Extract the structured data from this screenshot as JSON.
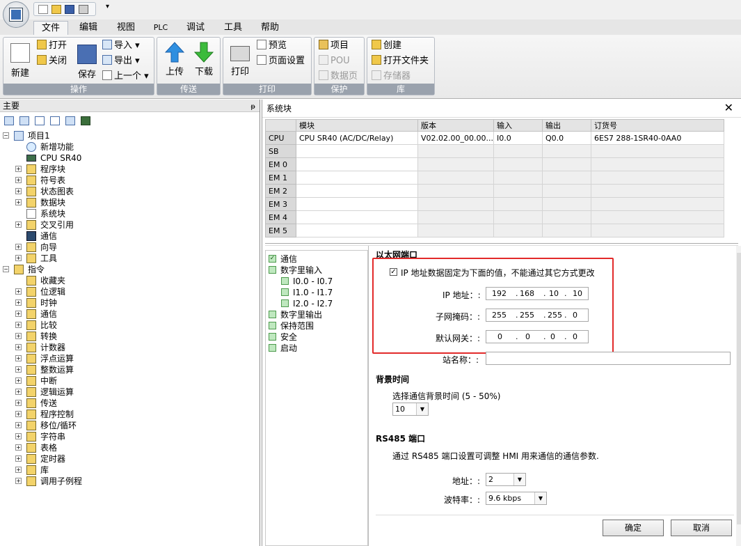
{
  "ribbon_tabs": [
    "文件",
    "编辑",
    "视图",
    "PLC",
    "调试",
    "工具",
    "帮助"
  ],
  "active_tab": "文件",
  "ribbon": {
    "new": "新建",
    "open": "打开",
    "close": "关闭",
    "save": "保存",
    "import": "导入",
    "export": "导出",
    "previous": "上一个",
    "group_ops": "操作",
    "upload": "上传",
    "download": "下载",
    "group_transfer": "传送",
    "print": "打印",
    "preview": "预览",
    "page_setup": "页面设置",
    "group_print": "打印",
    "project": "项目",
    "pou": "POU",
    "data_page": "数据页",
    "group_protect": "保护",
    "create": "创建",
    "open_folder": "打开文件夹",
    "memory": "存储器",
    "group_library": "库"
  },
  "left_panel": {
    "title": "主要",
    "tree": [
      {
        "label": "项目1",
        "indent": 0,
        "expander": "-",
        "icon": "project-icon"
      },
      {
        "label": "新增功能",
        "indent": 1,
        "expander": "",
        "icon": "help-icon"
      },
      {
        "label": "CPU SR40",
        "indent": 1,
        "expander": "",
        "icon": "cpu-icon"
      },
      {
        "label": "程序块",
        "indent": 1,
        "expander": "+",
        "icon": "folder-icon"
      },
      {
        "label": "符号表",
        "indent": 1,
        "expander": "+",
        "icon": "folder-icon"
      },
      {
        "label": "状态图表",
        "indent": 1,
        "expander": "+",
        "icon": "folder-icon"
      },
      {
        "label": "数据块",
        "indent": 1,
        "expander": "+",
        "icon": "folder-icon"
      },
      {
        "label": "系统块",
        "indent": 1,
        "expander": "",
        "icon": "document-icon"
      },
      {
        "label": "交叉引用",
        "indent": 1,
        "expander": "+",
        "icon": "folder-icon"
      },
      {
        "label": "通信",
        "indent": 1,
        "expander": "",
        "icon": "network-icon"
      },
      {
        "label": "向导",
        "indent": 1,
        "expander": "+",
        "icon": "wizard-icon"
      },
      {
        "label": "工具",
        "indent": 1,
        "expander": "+",
        "icon": "folder-icon"
      },
      {
        "label": "指令",
        "indent": 0,
        "expander": "-",
        "icon": "folder-icon"
      },
      {
        "label": "收藏夹",
        "indent": 1,
        "expander": "",
        "icon": "folder-icon"
      },
      {
        "label": "位逻辑",
        "indent": 1,
        "expander": "+",
        "icon": "folder-icon"
      },
      {
        "label": "时钟",
        "indent": 1,
        "expander": "+",
        "icon": "folder-icon"
      },
      {
        "label": "通信",
        "indent": 1,
        "expander": "+",
        "icon": "folder-icon"
      },
      {
        "label": "比较",
        "indent": 1,
        "expander": "+",
        "icon": "folder-icon"
      },
      {
        "label": "转换",
        "indent": 1,
        "expander": "+",
        "icon": "folder-icon"
      },
      {
        "label": "计数器",
        "indent": 1,
        "expander": "+",
        "icon": "folder-icon"
      },
      {
        "label": "浮点运算",
        "indent": 1,
        "expander": "+",
        "icon": "folder-icon"
      },
      {
        "label": "整数运算",
        "indent": 1,
        "expander": "+",
        "icon": "folder-icon"
      },
      {
        "label": "中断",
        "indent": 1,
        "expander": "+",
        "icon": "folder-icon"
      },
      {
        "label": "逻辑运算",
        "indent": 1,
        "expander": "+",
        "icon": "folder-icon"
      },
      {
        "label": "传送",
        "indent": 1,
        "expander": "+",
        "icon": "folder-icon"
      },
      {
        "label": "程序控制",
        "indent": 1,
        "expander": "+",
        "icon": "folder-icon"
      },
      {
        "label": "移位/循环",
        "indent": 1,
        "expander": "+",
        "icon": "folder-icon"
      },
      {
        "label": "字符串",
        "indent": 1,
        "expander": "+",
        "icon": "folder-icon"
      },
      {
        "label": "表格",
        "indent": 1,
        "expander": "+",
        "icon": "folder-icon"
      },
      {
        "label": "定时器",
        "indent": 1,
        "expander": "+",
        "icon": "folder-icon"
      },
      {
        "label": "库",
        "indent": 1,
        "expander": "+",
        "icon": "folder-icon"
      },
      {
        "label": "调用子例程",
        "indent": 1,
        "expander": "+",
        "icon": "folder-icon"
      }
    ]
  },
  "dialog": {
    "title": "系统块",
    "columns": [
      "",
      "模块",
      "版本",
      "输入",
      "输出",
      "订货号"
    ],
    "rows": [
      [
        "CPU",
        "CPU SR40 (AC/DC/Relay)",
        "V02.02.00_00.00...",
        "I0.0",
        "Q0.0",
        "6ES7 288-1SR40-0AA0"
      ],
      [
        "SB",
        "",
        "",
        "",
        "",
        ""
      ],
      [
        "EM 0",
        "",
        "",
        "",
        "",
        ""
      ],
      [
        "EM 1",
        "",
        "",
        "",
        "",
        ""
      ],
      [
        "EM 2",
        "",
        "",
        "",
        "",
        ""
      ],
      [
        "EM 3",
        "",
        "",
        "",
        "",
        ""
      ],
      [
        "EM 4",
        "",
        "",
        "",
        "",
        ""
      ],
      [
        "EM 5",
        "",
        "",
        "",
        "",
        ""
      ]
    ],
    "nav": [
      {
        "label": "通信",
        "checked": true,
        "indent": 0
      },
      {
        "label": "数字里输入",
        "checked": false,
        "indent": 0
      },
      {
        "label": "I0.0 - I0.7",
        "checked": false,
        "indent": 1
      },
      {
        "label": "I1.0 - I1.7",
        "checked": false,
        "indent": 1
      },
      {
        "label": "I2.0 - I2.7",
        "checked": false,
        "indent": 1
      },
      {
        "label": "数字里输出",
        "checked": false,
        "indent": 0
      },
      {
        "label": "保持范围",
        "checked": false,
        "indent": 0
      },
      {
        "label": "安全",
        "checked": false,
        "indent": 0
      },
      {
        "label": "启动",
        "checked": false,
        "indent": 0
      }
    ],
    "ethernet": {
      "section": "以太网端口",
      "fixed_ip_label": "IP 地址数据固定为下面的值，不能通过其它方式更改",
      "fixed_ip_checked": true,
      "ip_label": "IP 地址：:",
      "ip": [
        "192",
        "168",
        "10",
        "10"
      ],
      "mask_label": "子网掩码：:",
      "mask": [
        "255",
        "255",
        "255",
        "0"
      ],
      "gateway_label": "默认网关：:",
      "gateway": [
        "0",
        "0",
        "0",
        "0"
      ],
      "station_label": "站名称：:",
      "station_value": ""
    },
    "background": {
      "section": "背景时间",
      "label": "选择通信背景时间 (5 - 50%)",
      "value": "10"
    },
    "rs485": {
      "section": "RS485 端口",
      "desc": "通过 RS485 端口设置可调整 HMI 用来通信的通信参数.",
      "address_label": "地址：:",
      "address_value": "2",
      "baud_label": "波特率：:",
      "baud_value": "9.6 kbps"
    },
    "ok": "确定",
    "cancel": "取消",
    "highlight_color": "#e22a2a"
  }
}
